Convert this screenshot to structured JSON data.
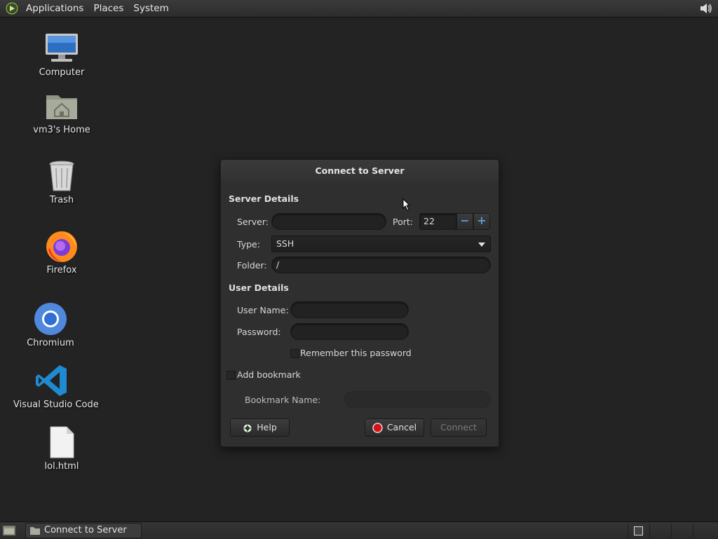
{
  "top_panel": {
    "menus": [
      "Applications",
      "Places",
      "System"
    ]
  },
  "desktop": {
    "icons": [
      {
        "label": "Computer",
        "icon": "computer-icon"
      },
      {
        "label": "vm3's Home",
        "icon": "home-folder-icon"
      },
      {
        "label": "Trash",
        "icon": "trash-icon"
      },
      {
        "label": "Firefox",
        "icon": "firefox-icon"
      },
      {
        "label": "Chromium",
        "icon": "chromium-icon"
      },
      {
        "label": "Visual Studio Code",
        "icon": "vscode-icon"
      },
      {
        "label": "lol.html",
        "icon": "html-file-icon"
      }
    ]
  },
  "dialog": {
    "title": "Connect to Server",
    "server_details_heading": "Server Details",
    "server_label": "Server:",
    "server_value": "",
    "port_label": "Port:",
    "port_value": "22",
    "type_label": "Type:",
    "type_value": "SSH",
    "folder_label": "Folder:",
    "folder_value": "/",
    "user_details_heading": "User Details",
    "username_label": "User Name:",
    "username_value": "",
    "password_label": "Password:",
    "password_value": "",
    "remember_label": "Remember this password",
    "add_bookmark_label": "Add bookmark",
    "bookmark_name_label": "Bookmark Name:",
    "bookmark_name_value": "",
    "help_button": "Help",
    "cancel_button": "Cancel",
    "connect_button": "Connect"
  },
  "bottom_panel": {
    "task_label": "Connect to Server"
  },
  "colors": {
    "desktop_bg": "#232323",
    "accent_blue": "#5c9ad8",
    "cancel_red": "#d6111b"
  }
}
